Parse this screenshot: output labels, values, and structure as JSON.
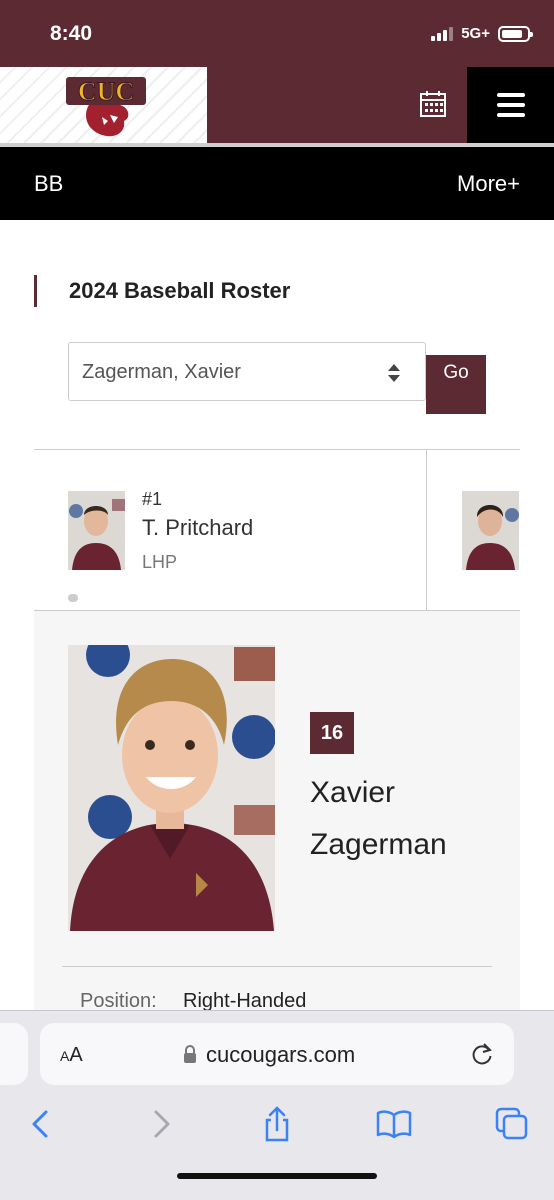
{
  "status_bar": {
    "time": "8:40",
    "network": "5G+",
    "battery_level": 0.85
  },
  "header": {
    "logo_text": "CUC",
    "calendar_icon": "calendar-icon",
    "menu_icon": "hamburger-menu-icon"
  },
  "section_nav": {
    "title": "BB",
    "more_label": "More+"
  },
  "roster": {
    "title": "2024 Baseball Roster",
    "player_select_value": "Zagerman, Xavier",
    "go_label": "Go"
  },
  "cards": [
    {
      "number": "#1",
      "name": "T. Pritchard",
      "position": "LHP"
    }
  ],
  "selected_player": {
    "number": "16",
    "first_name": "Xavier",
    "last_name": "Zagerman",
    "position_label": "Position:",
    "position_value": "Right-Handed"
  },
  "browser": {
    "aa_label": "AA",
    "url": "cucougars.com",
    "icons": [
      "back-icon",
      "forward-icon",
      "share-icon",
      "bookmarks-icon",
      "tabs-icon"
    ]
  },
  "colors": {
    "brand": "#5c2a33",
    "accent_blue": "#3b82f6"
  }
}
